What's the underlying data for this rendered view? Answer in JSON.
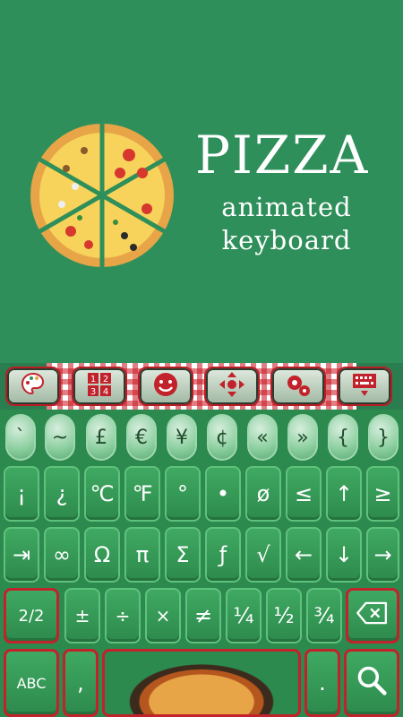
{
  "banner": {
    "title": "PIZZA",
    "subtitle_line1": "animated",
    "subtitle_line2": "keyboard",
    "background": "#2f8f5a"
  },
  "toolbar": {
    "buttons": [
      {
        "name": "theme-palette-icon"
      },
      {
        "name": "number-pad-icon"
      },
      {
        "name": "smiley-icon"
      },
      {
        "name": "move-arrows-icon"
      },
      {
        "name": "settings-gears-icon"
      },
      {
        "name": "keyboard-hide-icon"
      }
    ],
    "accent": "#b81d26"
  },
  "keyboard": {
    "row1": [
      "`",
      "~",
      "£",
      "€",
      "¥",
      "¢",
      "«",
      "»",
      "{",
      "}"
    ],
    "row2": [
      "¡",
      "¿",
      "℃",
      "℉",
      "°",
      "•",
      "ø",
      "≤",
      "↑",
      "≥"
    ],
    "row3": [
      "⇥",
      "∞",
      "Ω",
      "π",
      "Σ",
      "ƒ",
      "√",
      "←",
      "↓",
      "→"
    ],
    "row4": [
      "2/2",
      "±",
      "÷",
      "×",
      "≠",
      "¼",
      "½",
      "¾"
    ],
    "row5": {
      "abc": "ABC",
      "comma": ",",
      "period": "."
    },
    "key_color": "#2d8a4c",
    "highlight_border": "#c2222b"
  }
}
